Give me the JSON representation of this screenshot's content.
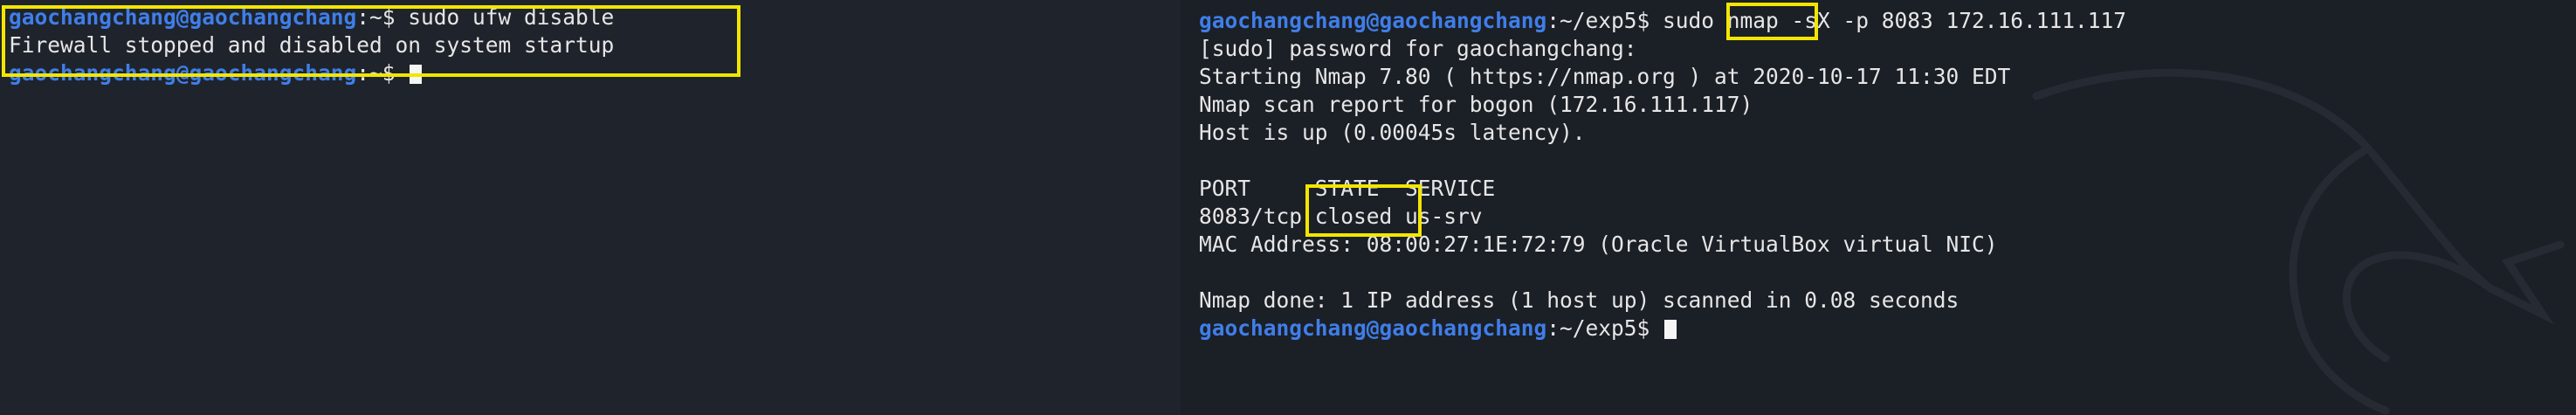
{
  "left_terminal": {
    "prompt_user": "gaochangchang@gaochangchang",
    "prompt_path": ":~$",
    "command": "sudo ufw disable",
    "output": "Firewall stopped and disabled on system startup",
    "prompt2_user": "gaochangchang@gaochangchang",
    "prompt2_path": ":~$"
  },
  "right_terminal": {
    "prompt_user": "gaochangchang@gaochangchang",
    "prompt_path": ":~/exp5$",
    "command": "sudo nmap -sX -p 8083 172.16.111.117",
    "sudo_line": "[sudo] password for gaochangchang:",
    "start_line": "Starting Nmap 7.80 ( https://nmap.org ) at 2020-10-17 11:30 EDT",
    "report_line": "Nmap scan report for bogon (172.16.111.117)",
    "host_line": "Host is up (0.00045s latency).",
    "table_header": "PORT     STATE  SERVICE",
    "table_row": "8083/tcp closed us-srv",
    "mac_line": "MAC Address: 08:00:27:1E:72:79 (Oracle VirtualBox virtual NIC)",
    "done_line": "Nmap done: 1 IP address (1 host up) scanned in 0.08 seconds",
    "prompt2_user": "gaochangchang@gaochangchang",
    "prompt2_path": ":~/exp5$"
  },
  "colors": {
    "prompt_user": "#3f7ee8",
    "highlight": "#f2e600",
    "background": "#1c2027"
  },
  "decor": {
    "watermark": "kali-dragon-icon"
  }
}
